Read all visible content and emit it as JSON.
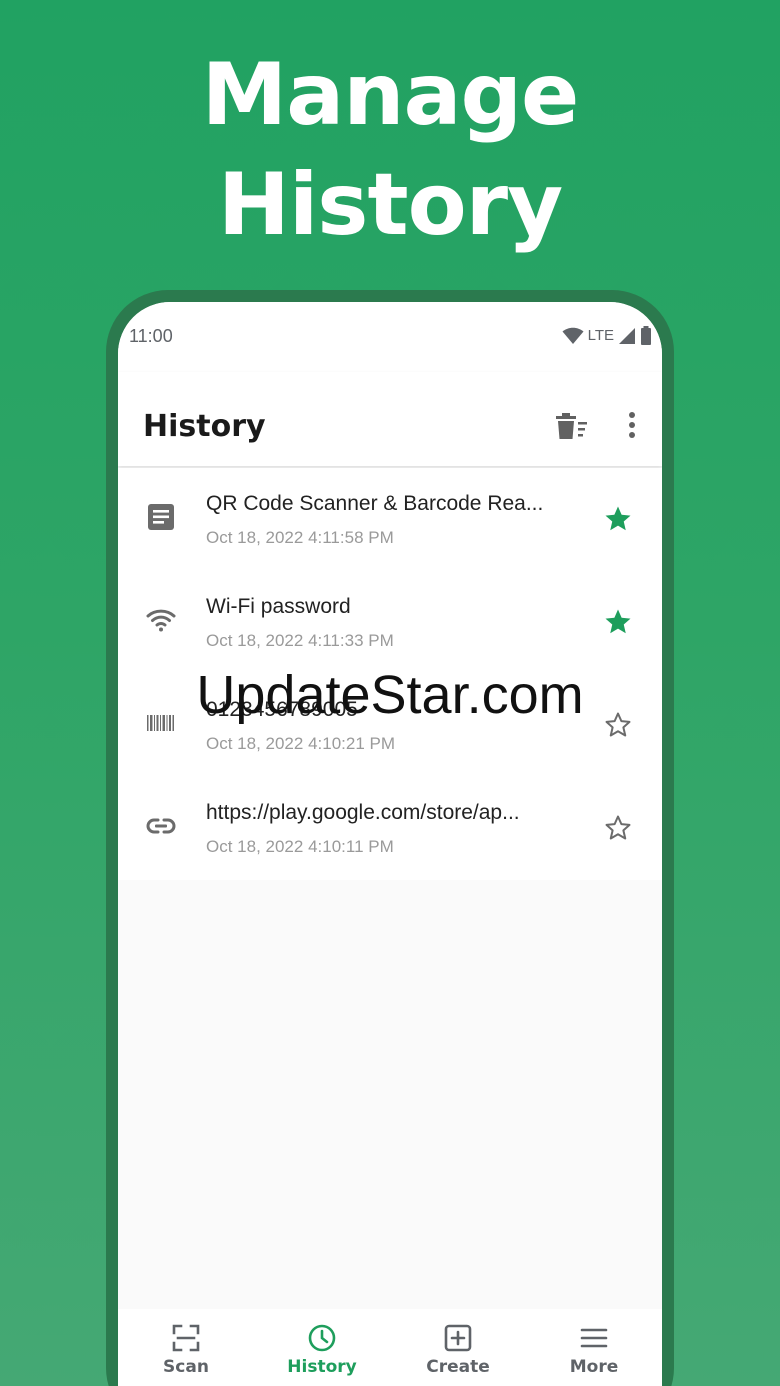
{
  "promo": {
    "headline_line1": "Manage",
    "headline_line2": "History"
  },
  "status_bar": {
    "time": "11:00",
    "network": "LTE",
    "icons": [
      "wifi-icon",
      "signal-icon",
      "battery-icon"
    ]
  },
  "app_bar": {
    "title": "History",
    "actions": [
      "delete-sort-icon",
      "more-vert-icon"
    ]
  },
  "history": [
    {
      "type": "text",
      "icon": "text-document-icon",
      "title": "QR Code Scanner & Barcode Rea...",
      "date": "Oct 18, 2022 4:11:58 PM",
      "starred": true
    },
    {
      "type": "wifi",
      "icon": "wifi-icon",
      "title": "Wi-Fi password",
      "date": "Oct 18, 2022 4:11:33 PM",
      "starred": true
    },
    {
      "type": "barcode",
      "icon": "barcode-icon",
      "title": "0123456789005",
      "date": "Oct 18, 2022 4:10:21 PM",
      "starred": false
    },
    {
      "type": "link",
      "icon": "link-icon",
      "title": "https://play.google.com/store/ap...",
      "date": "Oct 18, 2022 4:10:11 PM",
      "starred": false
    }
  ],
  "watermark": "UpdateStar.com",
  "bottom_nav": [
    {
      "label": "Scan",
      "icon": "scan-frame-icon",
      "active": false
    },
    {
      "label": "History",
      "icon": "clock-icon",
      "active": true
    },
    {
      "label": "Create",
      "icon": "add-box-icon",
      "active": false
    },
    {
      "label": "More",
      "icon": "menu-icon",
      "active": false
    }
  ],
  "colors": {
    "background": "#26a364",
    "accent": "#1e9e5c",
    "phone_frame": "#2b7a4e",
    "star_filled": "#1e9e5c",
    "icon_gray": "#6b6b6b"
  }
}
